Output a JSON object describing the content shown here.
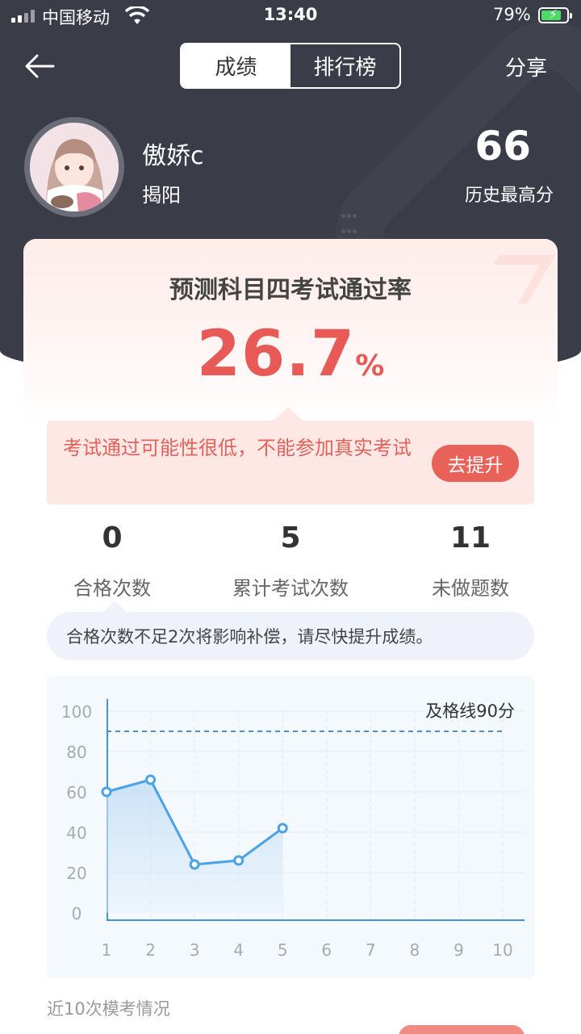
{
  "status_bar": {
    "carrier": "中国移动",
    "time": "13:40",
    "battery_percent": "79%",
    "battery_level": 0.79
  },
  "nav": {
    "tabs": [
      {
        "label": "成绩",
        "active": true
      },
      {
        "label": "排行榜",
        "active": false
      }
    ],
    "share_label": "分享"
  },
  "profile": {
    "username": "傲娇c",
    "city": "揭阳",
    "best_score": "66",
    "best_score_label": "历史最高分"
  },
  "prediction": {
    "title": "预测科目四考试通过率",
    "rate_value": "26.7",
    "rate_unit": "%",
    "warning_text": "考试通过可能性很低，不能参加真实考试",
    "improve_button": "去提升"
  },
  "stats": [
    {
      "value": "0",
      "label": "合格次数"
    },
    {
      "value": "5",
      "label": "累计考试次数"
    },
    {
      "value": "11",
      "label": "未做题数"
    }
  ],
  "tip_text": "合格次数不足2次将影响补偿，请尽快提升成绩。",
  "chart_caption": "近10次模考情况",
  "colors": {
    "header_bg": "#3a3c48",
    "accent_red": "#e85a55",
    "line_blue": "#4aa3e8"
  },
  "chart_data": {
    "type": "line",
    "x": [
      1,
      2,
      3,
      4,
      5,
      6,
      7,
      8,
      9,
      10
    ],
    "series": [
      {
        "values": [
          60,
          66,
          24,
          26,
          42
        ]
      }
    ],
    "y_ticks": [
      0,
      20,
      40,
      60,
      80,
      100
    ],
    "ylim": [
      0,
      100
    ],
    "xlim": [
      1,
      10
    ],
    "threshold": {
      "value": 90,
      "label": "及格线90分"
    },
    "grid": true
  }
}
